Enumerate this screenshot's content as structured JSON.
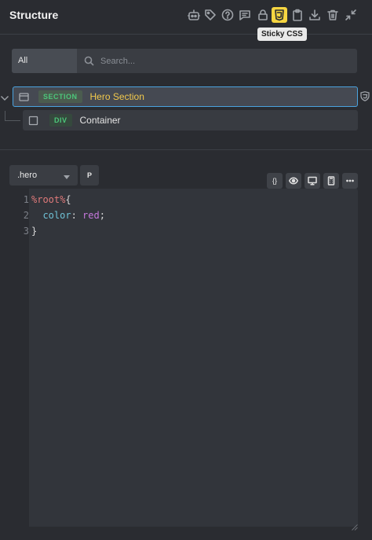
{
  "header": {
    "title": "Structure",
    "tooltip": "Sticky CSS",
    "icons": [
      "robot-icon",
      "tag-icon",
      "help-icon",
      "comment-icon",
      "lock-icon",
      "css3-icon",
      "clipboard-icon",
      "download-icon",
      "trash-icon",
      "collapse-icon"
    ],
    "accent": "#f6d541"
  },
  "filter": {
    "all_label": "All",
    "search_placeholder": "Search..."
  },
  "tree": {
    "nodes": [
      {
        "tag": "SECTION",
        "label": "Hero Section",
        "selected": true
      },
      {
        "tag": "DIV",
        "label": "Container",
        "selected": false
      }
    ],
    "selection_color": "#4aa3df"
  },
  "css_panel": {
    "selector": ".hero",
    "p_label": "P",
    "tool_labels": {
      "braces": "{}"
    },
    "line_numbers": [
      "1",
      "2",
      "3"
    ],
    "code": {
      "line1_sel": "%root%",
      "line1_open": "{",
      "line2_prop": "color",
      "line2_colon": ": ",
      "line2_val": "red",
      "line2_semi": ";",
      "line3_close": "}"
    }
  }
}
